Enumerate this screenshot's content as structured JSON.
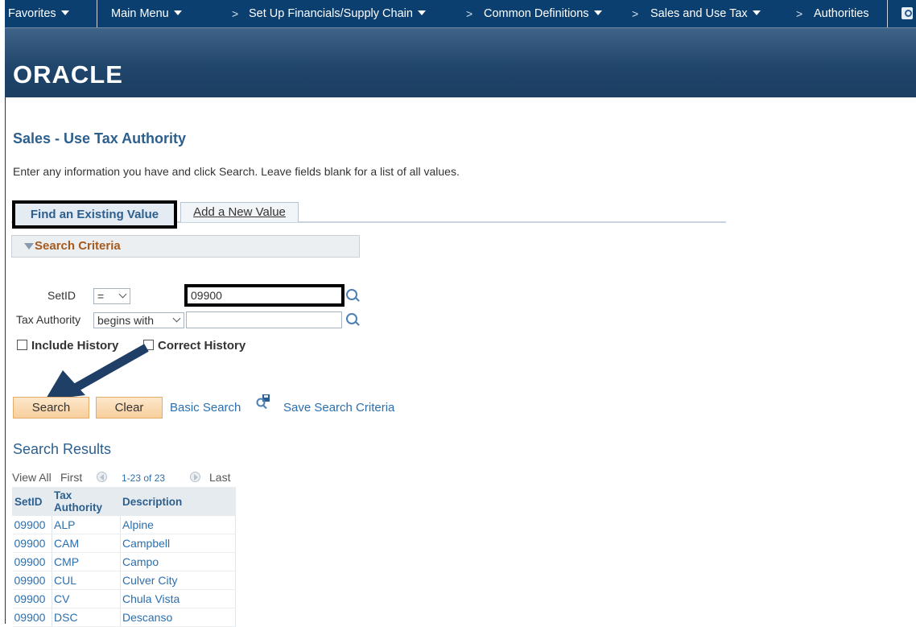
{
  "nav": {
    "favorites": "Favorites",
    "main_menu": "Main Menu",
    "crumbs": [
      "Set Up Financials/Supply Chain",
      "Common Definitions",
      "Sales and Use Tax",
      "Authorities"
    ]
  },
  "banner": {
    "logo": "ORACLE"
  },
  "page": {
    "title": "Sales - Use Tax Authority",
    "instructions": "Enter any information you have and click Search. Leave fields blank for a list of all values."
  },
  "tabs": {
    "find_existing": "Find an Existing Value",
    "add_new": "Add a New Value"
  },
  "search_criteria": {
    "header": "Search Criteria",
    "setid": {
      "label": "SetID",
      "operator": "=",
      "value": "09900"
    },
    "tax_authority": {
      "label": "Tax Authority",
      "operator": "begins with",
      "value": ""
    },
    "include_history": {
      "label": "Include History",
      "checked": false
    },
    "correct_history": {
      "label": "Correct History",
      "checked": false
    }
  },
  "actions": {
    "search": "Search",
    "clear": "Clear",
    "basic_search": "Basic Search",
    "save_search": "Save Search Criteria"
  },
  "results": {
    "title": "Search Results",
    "view_all": "View All",
    "first": "First",
    "range": "1-23 of 23",
    "last": "Last",
    "columns": [
      "SetID",
      "Tax Authority",
      "Description"
    ],
    "rows": [
      [
        "09900",
        "ALP",
        "Alpine"
      ],
      [
        "09900",
        "CAM",
        "Campbell"
      ],
      [
        "09900",
        "CMP",
        "Campo"
      ],
      [
        "09900",
        "CUL",
        "Culver City"
      ],
      [
        "09900",
        "CV",
        "Chula Vista"
      ],
      [
        "09900",
        "DSC",
        "Descanso"
      ]
    ]
  },
  "colors": {
    "nav_bg": "#0b3f70",
    "title": "#2d5f8e",
    "link": "#2a6fb0",
    "criteria_header": "#a65a1d",
    "button_bg": "#f7cf9b",
    "arrow": "#1f3f66"
  }
}
